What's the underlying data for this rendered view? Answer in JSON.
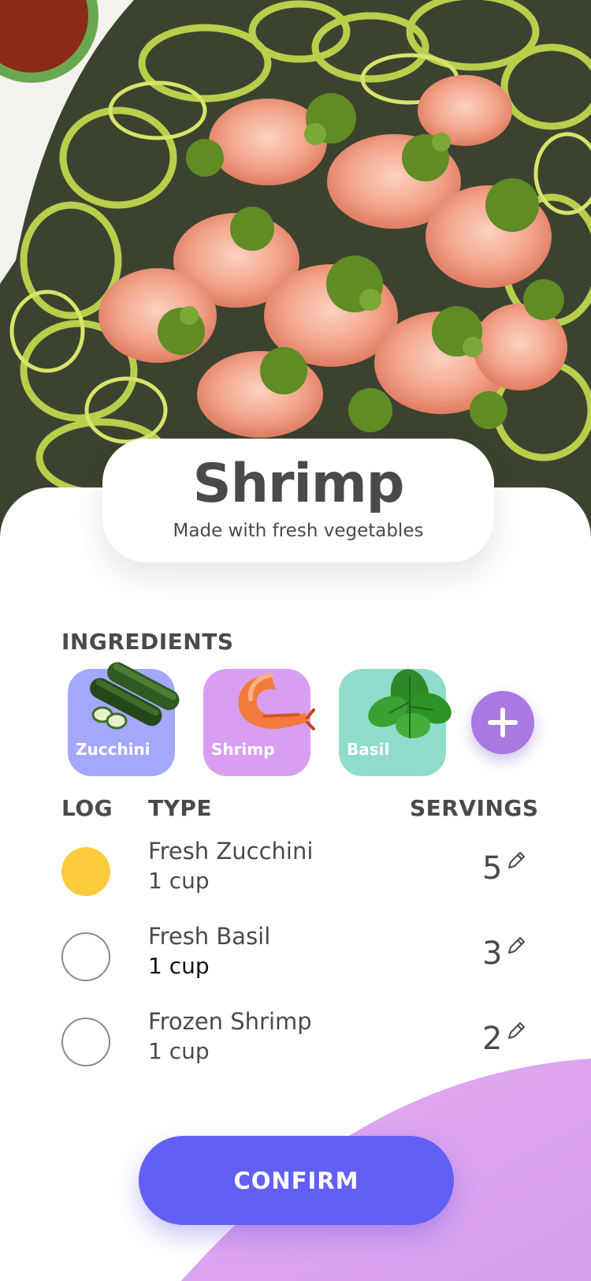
{
  "dish": {
    "title": "Shrimp",
    "subtitle": "Made with fresh vegetables"
  },
  "ingredients": {
    "heading": "INGREDIENTS",
    "chips": [
      {
        "label": "Zucchini",
        "color": "#a3a8fa",
        "icon": "zucchini-icon"
      },
      {
        "label": "Shrimp",
        "color": "#d89ef2",
        "icon": "shrimp-icon"
      },
      {
        "label": "Basil",
        "color": "#8fdccb",
        "icon": "basil-icon"
      }
    ],
    "add_icon": "plus-icon",
    "add_color": "#a978e0"
  },
  "log_table": {
    "headers": {
      "log": "LOG",
      "type": "TYPE",
      "servings": "SERVINGS"
    },
    "rows": [
      {
        "name": "Fresh Zucchini",
        "unit": "1 cup",
        "servings": "5",
        "logged": true
      },
      {
        "name": "Fresh Basil",
        "unit": "1 cup",
        "servings": "3",
        "logged": false
      },
      {
        "name": "Frozen Shrimp",
        "unit": "1 cup",
        "servings": "2",
        "logged": false
      }
    ],
    "edit_icon": "pencil-icon",
    "logged_color": "#fecb3f"
  },
  "actions": {
    "confirm_label": "CONFIRM",
    "confirm_color": "#625ff7"
  }
}
